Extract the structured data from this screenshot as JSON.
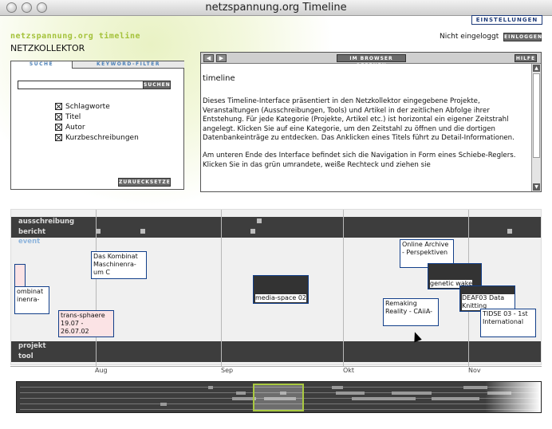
{
  "window": {
    "title": "netzspannung.org Timeline"
  },
  "header": {
    "settings_label": "EINSTELLUNGEN",
    "app_title": "netzspannung.org timeline",
    "app_subtitle": "NETZKOLLEKTOR",
    "login_status": "Nicht eingeloggt",
    "login_label": "EINLOGGEN"
  },
  "search_panel": {
    "tabs": [
      {
        "label": "SUCHE"
      },
      {
        "label": "KEYWORD-FILTER"
      }
    ],
    "search_value": "",
    "search_button": "SUCHEN",
    "checkboxes": [
      {
        "label": "Schlagworte",
        "checked": true
      },
      {
        "label": "Titel",
        "checked": true
      },
      {
        "label": "Autor",
        "checked": true
      },
      {
        "label": "Kurzbeschreibungen",
        "checked": true
      }
    ],
    "reset_button": "ZURUECKSETZEN"
  },
  "description_panel": {
    "back_icon": "chevron-left-icon",
    "forward_icon": "chevron-right-icon",
    "open_browser_label": "IM BROWSER OEFFNEN",
    "help_label": "HILFE",
    "heading": "timeline",
    "paragraphs": [
      "Dieses Timeline-Interface präsentiert in den Netzkollektor eingegebene Projekte, Veranstaltungen (Ausschreibungen, Tools) und Artikel in der zeitlichen Abfolge ihrer Entstehung. Für jede Kategorie (Projekte, Artikel etc.) ist horizontal ein eigener Zeitstrahl angelegt. Klicken Sie auf eine Kategorie, um den Zeitstahl zu öffnen und die dortigen Datenbankeinträge zu entdecken. Das Anklicken eines Titels führt zu Detail-Informationen.",
      "Am unteren Ende des Interface befindet sich die Navigation in Form eines Schiebe-Reglers. Klicken Sie in das grün umrandete, weiße Rechteck und ziehen sie"
    ]
  },
  "timeline": {
    "categories": [
      "ausschreibung",
      "bericht",
      "event",
      "projekt",
      "tool"
    ],
    "events": [
      {
        "label": "ombinat inenra-"
      },
      {
        "label": "Das Kombinat Maschinenra-um C"
      },
      {
        "label": "trans-sphaere 19.07 - 26.07.02"
      },
      {
        "label": "media-space 02"
      },
      {
        "label": "Online Archive - Perspektiven"
      },
      {
        "label": "genetic wake"
      },
      {
        "label": "Remaking Reality - CAiiA-"
      },
      {
        "label": "DEAF03 Data Knitting"
      },
      {
        "label": "TIDSE 03 - 1st International"
      }
    ],
    "months": [
      "Aug",
      "Sep",
      "Okt",
      "Nov"
    ]
  }
}
